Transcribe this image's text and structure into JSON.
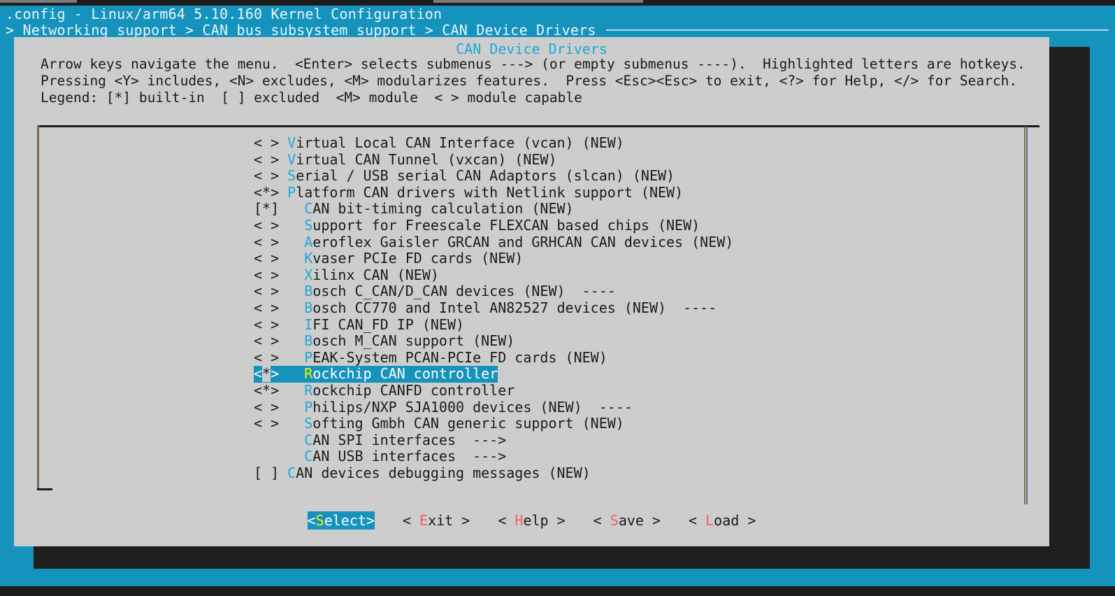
{
  "window": {
    "title": ".config - Linux/arm64 5.10.160 Kernel Configuration",
    "breadcrumb": "> Networking support > CAN bus subsystem support > CAN Device Drivers"
  },
  "dialog": {
    "title": "CAN Device Drivers",
    "instructions": {
      "line1": "Arrow keys navigate the menu.  <Enter> selects submenus ---> (or empty submenus ----).  Highlighted letters are hotkeys.",
      "line2": "Pressing <Y> includes, <N> excludes, <M> modularizes features.  Press <Esc><Esc> to exit, <?> for Help, </> for Search.",
      "line3": "Legend: [*] built-in  [ ] excluded  <M> module  < > module capable"
    }
  },
  "menu": {
    "items": [
      {
        "mark": "< >",
        "indent": "",
        "hotkey": "V",
        "text": "irtual Local CAN Interface (vcan) (NEW)",
        "selected": false
      },
      {
        "mark": "< >",
        "indent": "",
        "hotkey": "V",
        "text": "irtual CAN Tunnel (vxcan) (NEW)",
        "selected": false
      },
      {
        "mark": "< >",
        "indent": "",
        "hotkey": "S",
        "text": "erial / USB serial CAN Adaptors (slcan) (NEW)",
        "selected": false
      },
      {
        "mark": "<*>",
        "indent": "",
        "hotkey": "P",
        "text": "latform CAN drivers with Netlink support (NEW)",
        "selected": false
      },
      {
        "mark": "[*]",
        "indent": "  ",
        "hotkey": "C",
        "text": "AN bit-timing calculation (NEW)",
        "selected": false
      },
      {
        "mark": "< >",
        "indent": "  ",
        "hotkey": "S",
        "text": "upport for Freescale FLEXCAN based chips (NEW)",
        "selected": false
      },
      {
        "mark": "< >",
        "indent": "  ",
        "hotkey": "A",
        "text": "eroflex Gaisler GRCAN and GRHCAN CAN devices (NEW)",
        "selected": false
      },
      {
        "mark": "< >",
        "indent": "  ",
        "hotkey": "K",
        "text": "vaser PCIe FD cards (NEW)",
        "selected": false
      },
      {
        "mark": "< >",
        "indent": "  ",
        "hotkey": "X",
        "text": "ilinx CAN (NEW)",
        "selected": false
      },
      {
        "mark": "< >",
        "indent": "  ",
        "hotkey": "B",
        "text": "osch C_CAN/D_CAN devices (NEW)  ----",
        "selected": false
      },
      {
        "mark": "< >",
        "indent": "  ",
        "hotkey": "B",
        "text": "osch CC770 and Intel AN82527 devices (NEW)  ----",
        "selected": false
      },
      {
        "mark": "< >",
        "indent": "  ",
        "hotkey": "I",
        "text": "FI CAN_FD IP (NEW)",
        "selected": false
      },
      {
        "mark": "< >",
        "indent": "  ",
        "hotkey": "B",
        "text": "osch M_CAN support (NEW)",
        "selected": false
      },
      {
        "mark": "< >",
        "indent": "  ",
        "hotkey": "P",
        "text": "EAK-System PCAN-PCIe FD cards (NEW)",
        "selected": false
      },
      {
        "mark": "<*>",
        "indent": "  ",
        "hotkey": "R",
        "text": "ockchip CAN controller",
        "selected": true
      },
      {
        "mark": "<*>",
        "indent": "  ",
        "hotkey": "R",
        "text": "ockchip CANFD controller",
        "selected": false
      },
      {
        "mark": "< >",
        "indent": "  ",
        "hotkey": "P",
        "text": "hilips/NXP SJA1000 devices (NEW)  ----",
        "selected": false
      },
      {
        "mark": "< >",
        "indent": "  ",
        "hotkey": "S",
        "text": "ofting Gmbh CAN generic support (NEW)",
        "selected": false
      },
      {
        "mark": "   ",
        "indent": "  ",
        "hotkey": "C",
        "text": "AN SPI interfaces  --->",
        "selected": false
      },
      {
        "mark": "   ",
        "indent": "  ",
        "hotkey": "C",
        "text": "AN USB interfaces  --->",
        "selected": false
      },
      {
        "mark": "[ ]",
        "indent": "",
        "hotkey": "C",
        "text": "AN devices debugging messages (NEW)",
        "selected": false
      }
    ]
  },
  "buttons": [
    {
      "pre": "<",
      "hotkey": "S",
      "post": "elect>",
      "active": true
    },
    {
      "pre": "< ",
      "hotkey": "E",
      "post": "xit >",
      "active": false
    },
    {
      "pre": "< ",
      "hotkey": "H",
      "post": "elp >",
      "active": false
    },
    {
      "pre": "< ",
      "hotkey": "S",
      "post": "ave >",
      "active": false
    },
    {
      "pre": "< ",
      "hotkey": "L",
      "post": "oad >",
      "active": false
    }
  ],
  "colors": {
    "terminal_bg": "#1693bd",
    "dialog_bg": "#cdcdcd",
    "highlight_bg": "#1693bd",
    "hotkey": "#21a7d6",
    "hotkey_selected": "#f2f200",
    "button_hotkey": "#f4645f",
    "shadow": "#1f1f1f"
  }
}
